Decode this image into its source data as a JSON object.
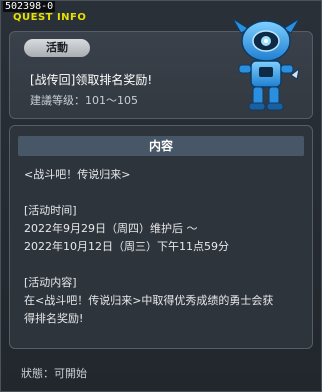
{
  "window": {
    "quest_id": "502398-0",
    "title": "QUEST INFO"
  },
  "header": {
    "category": "活動",
    "quest_title": "[战传回]领取排名奖励!",
    "level_label": "建議等级：",
    "level_range": "101～105",
    "mascot_icon": "robot-mascot-icon"
  },
  "content": {
    "header": "内容",
    "lines": [
      "<战斗吧！传说归来>",
      "",
      "[活动时间]",
      "2022年9月29日（周四）维护后 ～",
      "2022年10月12日（周三）下午11点59分",
      "",
      "[活动内容]",
      "在<战斗吧！传说归来>中取得优秀成绩的勇士会获",
      "得排名奖励!"
    ]
  },
  "footer": {
    "status_label": "狀態：",
    "status_value": "可開始"
  },
  "colors": {
    "title_yellow": "#e8e000",
    "section_header": "#485767",
    "background": "#22272e",
    "mascot_blue": "#3fa9f5"
  }
}
